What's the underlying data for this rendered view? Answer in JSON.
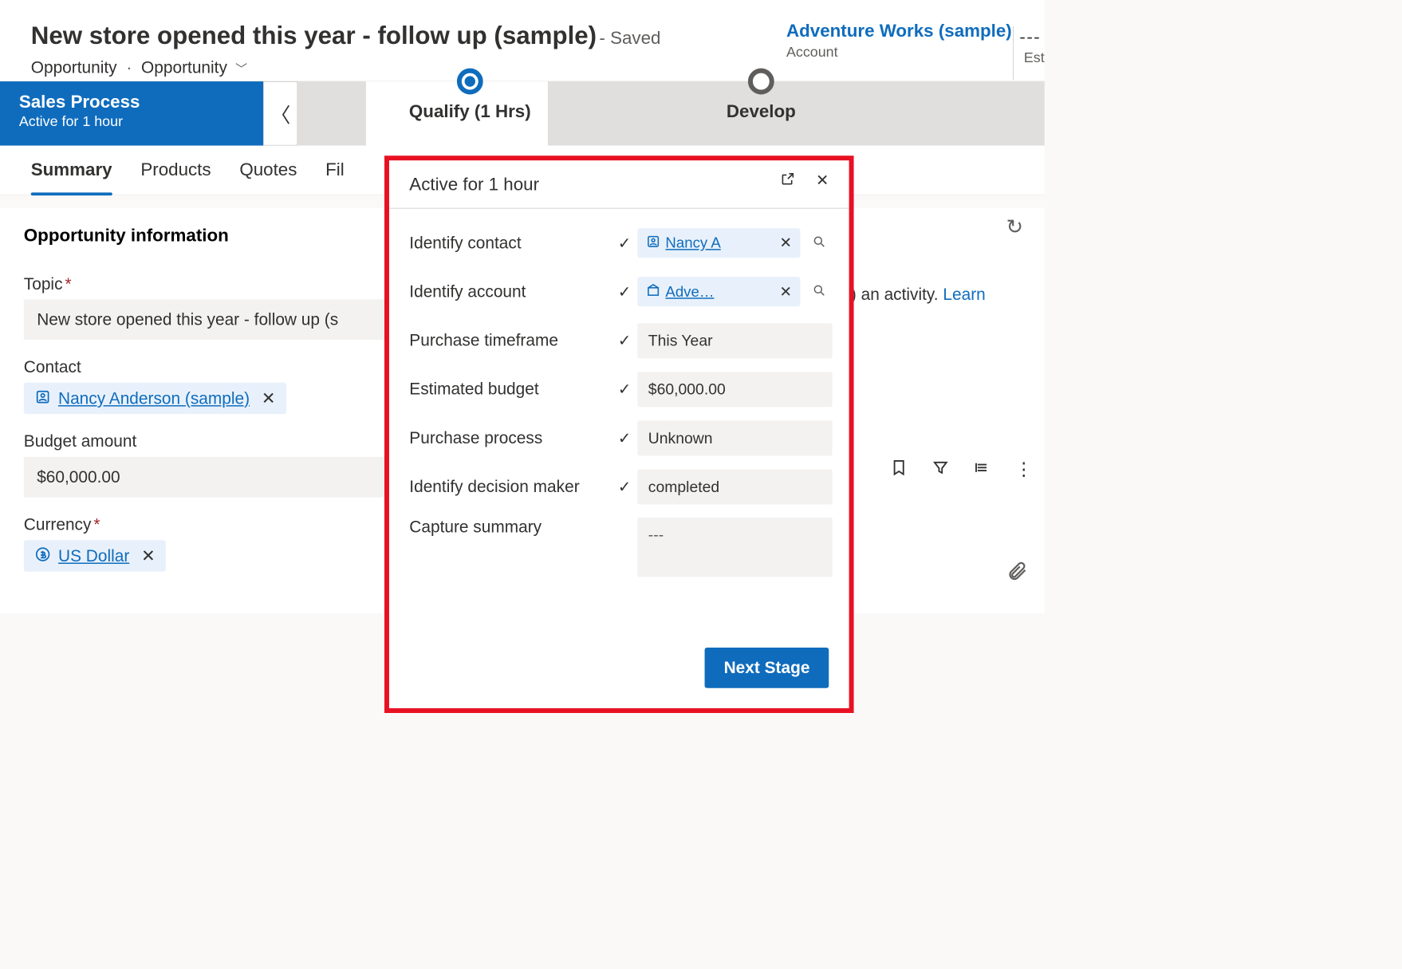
{
  "header": {
    "title": "New store opened this year - follow up (sample)",
    "saved": "- Saved",
    "entity": "Opportunity",
    "form_selector": "Opportunity",
    "account_name": "Adventure Works (sample)",
    "account_label": "Account",
    "est_label": "Est",
    "dots": "---"
  },
  "process": {
    "title": "Sales Process",
    "subtitle": "Active for 1 hour",
    "stages": [
      {
        "label": "Qualify  (1 Hrs)",
        "active": true
      },
      {
        "label": "Develop",
        "active": false
      }
    ]
  },
  "tabs": [
    {
      "label": "Summary",
      "active": true
    },
    {
      "label": "Products",
      "active": false
    },
    {
      "label": "Quotes",
      "active": false
    },
    {
      "label": "Fil",
      "active": false
    }
  ],
  "section": {
    "heading": "Opportunity information",
    "topic_label": "Topic",
    "topic_value": "New store opened this year - follow up (s",
    "contact_label": "Contact",
    "contact_value": "Nancy Anderson (sample)",
    "budget_label": "Budget amount",
    "budget_value": "$60,000.00",
    "currency_label": "Currency",
    "currency_value": "US Dollar"
  },
  "hint": {
    "prefix": "an activity. ",
    "link": "Learn"
  },
  "flyout": {
    "title": "Active for 1 hour",
    "rows": {
      "identify_contact": {
        "label": "Identify contact",
        "value": "Nancy A"
      },
      "identify_account": {
        "label": "Identify account",
        "value": "Adve…"
      },
      "purchase_timeframe": {
        "label": "Purchase timeframe",
        "value": "This Year"
      },
      "estimated_budget": {
        "label": "Estimated budget",
        "value": "$60,000.00"
      },
      "purchase_process": {
        "label": "Purchase process",
        "value": "Unknown"
      },
      "decision_maker": {
        "label": "Identify decision maker",
        "value": "completed"
      },
      "capture_summary": {
        "label": "Capture summary",
        "value": "---"
      }
    },
    "next_stage": "Next Stage"
  }
}
